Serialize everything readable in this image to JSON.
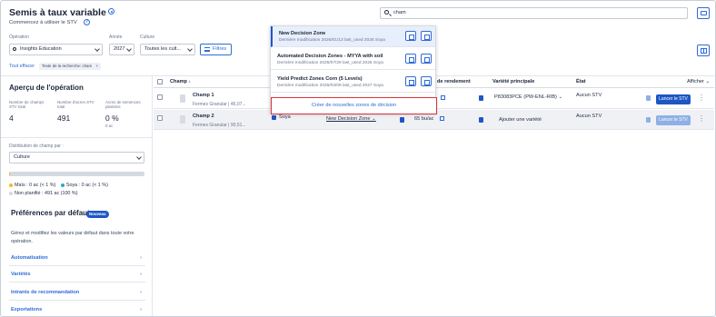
{
  "header": {
    "title": "Semis à taux variable",
    "subtitle": "Commencez à utiliser le STV",
    "search_value": "cham"
  },
  "filters": {
    "operation_label": "Opération",
    "operation_value": "Insights Education",
    "year_label": "Année",
    "year_value": "2027",
    "culture_label": "Culture",
    "culture_value": "Toutes les cult...",
    "filters_button": "Filtres",
    "clear_all": "Tout effacer",
    "chip": "Texte de la recherche: cham"
  },
  "overview": {
    "title": "Aperçu de l'opération",
    "stats": [
      {
        "label": "Nombre de champs STV total",
        "value": "4",
        "sub": ""
      },
      {
        "label": "Nombre d'acres STV total",
        "value": "491",
        "sub": ""
      },
      {
        "label": "Acres de semences plantées",
        "value": "0 %",
        "sub": "0 ac"
      }
    ],
    "distribution_label": "Distribution de champ par :",
    "distribution_value": "Culture",
    "legend": [
      {
        "text": "Maïs : 0 ac (< 1 %)",
        "color": "#f1b928"
      },
      {
        "text": "Soya : 0 ac (< 1 %)",
        "color": "#2aa7c9"
      },
      {
        "text": "Non planifié : 491 ac (100 %)",
        "color": "#d5d9e2"
      }
    ],
    "bar_fill_percent": 1
  },
  "preferences": {
    "title": "Préférences par défaut",
    "badge": "Nouveau",
    "description": "Gérez et modifiez les valeurs par défaut dans toute votre opération.",
    "items": [
      "Automatisation",
      "Variétés",
      "Intrants de recommandation",
      "Exportations"
    ]
  },
  "table": {
    "headers": {
      "champ": "Champ",
      "rendement": "de rendement",
      "variete": "Variété principale",
      "etat": "État",
      "afficher": "Afficher"
    },
    "rows": [
      {
        "name": "Champ 1",
        "farm": "Fermes Granular",
        "acres": "46,07...",
        "culture": "",
        "zone": "",
        "rendement": "",
        "variete": "P83083PCE (PW-ENL-RIB)",
        "etat": "Aucun STV",
        "action": "Lancer le STV"
      },
      {
        "name": "Champ 2",
        "farm": "Fermes Granular",
        "acres": "90,51...",
        "culture": "Soya",
        "zone": "New Decision Zone",
        "rendement": "65 bu/ac",
        "variete": "Ajouter une variété",
        "etat": "Aucun STV",
        "action": "Lancer le STV"
      }
    ]
  },
  "dropdown": {
    "items": [
      {
        "name": "New Decision Zone",
        "meta": "Dernière modification 2026/01/13 last_used 2026 Soya"
      },
      {
        "name": "Automated Decision Zones - MYYA with soil",
        "meta": "Dernière modification 2025/07/29 last_used 2025 Soya"
      },
      {
        "name": "Yield Predict Zones Corn (5 Levels)",
        "meta": "Dernière modification 2026/03/09 last_used 2027 Soya"
      }
    ],
    "create_label": "Créer de nouvelles zones de décision"
  }
}
